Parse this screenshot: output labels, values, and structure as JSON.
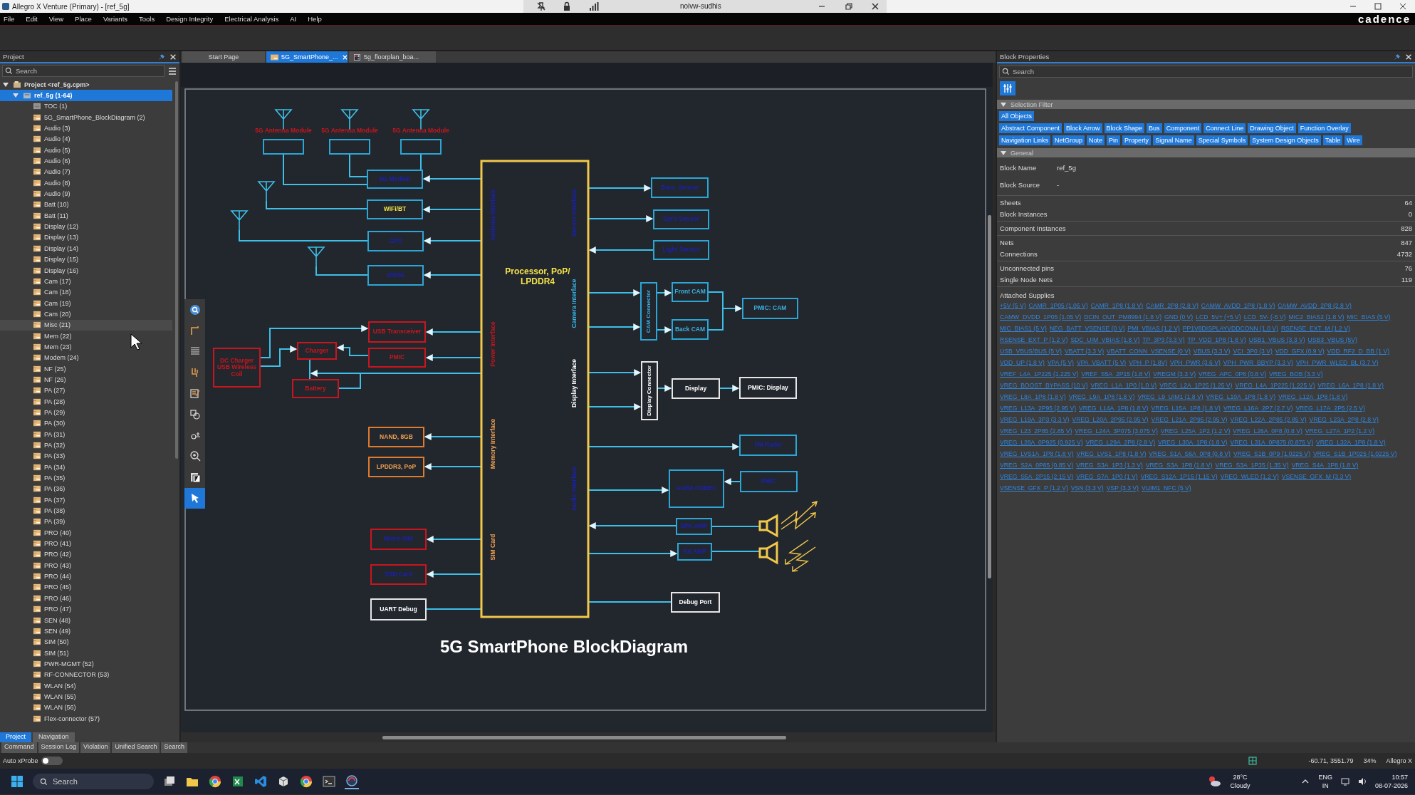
{
  "window": {
    "title": "Allegro X Venture (Primary) - [ref_5g]",
    "remote_title": "noivw-sudhis"
  },
  "menu": [
    "File",
    "Edit",
    "View",
    "Place",
    "Variants",
    "Tools",
    "Design Integrity",
    "Electrical Analysis",
    "AI",
    "Help"
  ],
  "brand": "cadence",
  "project_panel": {
    "title": "Project",
    "search_placeholder": "Search",
    "tree": {
      "label": "Project <ref_5g.cpm>",
      "expanded": true,
      "selected": false,
      "children": [
        {
          "label": "ref_5g (1-64)",
          "expanded": true,
          "selected": true,
          "children": [
            {
              "label": "TOC (1)",
              "kind": "toc",
              "hovered": false
            },
            {
              "label": "5G_SmartPhone_BlockDiagram (2)",
              "kind": "sheet",
              "hovered": false
            },
            {
              "label": "Audio (3)",
              "kind": "sheet",
              "hovered": false
            },
            {
              "label": "Audio (4)",
              "kind": "sheet",
              "hovered": false
            },
            {
              "label": "Audio (5)",
              "kind": "sheet",
              "hovered": false
            },
            {
              "label": "Audio (6)",
              "kind": "sheet",
              "hovered": false
            },
            {
              "label": "Audio (7)",
              "kind": "sheet",
              "hovered": false
            },
            {
              "label": "Audio (8)",
              "kind": "sheet",
              "hovered": false
            },
            {
              "label": "Audio (9)",
              "kind": "sheet",
              "hovered": false
            },
            {
              "label": "Batt (10)",
              "kind": "sheet",
              "hovered": false
            },
            {
              "label": "Batt (11)",
              "kind": "sheet",
              "hovered": false
            },
            {
              "label": "Display (12)",
              "kind": "sheet",
              "hovered": false
            },
            {
              "label": "Display (13)",
              "kind": "sheet",
              "hovered": false
            },
            {
              "label": "Display (14)",
              "kind": "sheet",
              "hovered": false
            },
            {
              "label": "Display (15)",
              "kind": "sheet",
              "hovered": false
            },
            {
              "label": "Display (16)",
              "kind": "sheet",
              "hovered": false
            },
            {
              "label": "Cam (17)",
              "kind": "sheet",
              "hovered": false
            },
            {
              "label": "Cam (18)",
              "kind": "sheet",
              "hovered": false
            },
            {
              "label": "Cam (19)",
              "kind": "sheet",
              "hovered": false
            },
            {
              "label": "Cam (20)",
              "kind": "sheet",
              "hovered": false
            },
            {
              "label": "Misc (21)",
              "kind": "sheet",
              "hovered": true
            },
            {
              "label": "Mem (22)",
              "kind": "sheet",
              "hovered": false
            },
            {
              "label": "Mem (23)",
              "kind": "sheet",
              "hovered": false
            },
            {
              "label": "Modem (24)",
              "kind": "sheet",
              "hovered": false
            },
            {
              "label": "NF (25)",
              "kind": "sheet",
              "hovered": false
            },
            {
              "label": "NF (26)",
              "kind": "sheet",
              "hovered": false
            },
            {
              "label": "PA (27)",
              "kind": "sheet",
              "hovered": false
            },
            {
              "label": "PA (28)",
              "kind": "sheet",
              "hovered": false
            },
            {
              "label": "PA (29)",
              "kind": "sheet",
              "hovered": false
            },
            {
              "label": "PA (30)",
              "kind": "sheet",
              "hovered": false
            },
            {
              "label": "PA (31)",
              "kind": "sheet",
              "hovered": false
            },
            {
              "label": "PA (32)",
              "kind": "sheet",
              "hovered": false
            },
            {
              "label": "PA (33)",
              "kind": "sheet",
              "hovered": false
            },
            {
              "label": "PA (34)",
              "kind": "sheet",
              "hovered": false
            },
            {
              "label": "PA (35)",
              "kind": "sheet",
              "hovered": false
            },
            {
              "label": "PA (36)",
              "kind": "sheet",
              "hovered": false
            },
            {
              "label": "PA (37)",
              "kind": "sheet",
              "hovered": false
            },
            {
              "label": "PA (38)",
              "kind": "sheet",
              "hovered": false
            },
            {
              "label": "PA (39)",
              "kind": "sheet",
              "hovered": false
            },
            {
              "label": "PRO (40)",
              "kind": "sheet",
              "hovered": false
            },
            {
              "label": "PRO (41)",
              "kind": "sheet",
              "hovered": false
            },
            {
              "label": "PRO (42)",
              "kind": "sheet",
              "hovered": false
            },
            {
              "label": "PRO (43)",
              "kind": "sheet",
              "hovered": false
            },
            {
              "label": "PRO (44)",
              "kind": "sheet",
              "hovered": false
            },
            {
              "label": "PRO (45)",
              "kind": "sheet",
              "hovered": false
            },
            {
              "label": "PRO (46)",
              "kind": "sheet",
              "hovered": false
            },
            {
              "label": "PRO (47)",
              "kind": "sheet",
              "hovered": false
            },
            {
              "label": "SEN (48)",
              "kind": "sheet",
              "hovered": false
            },
            {
              "label": "SEN (49)",
              "kind": "sheet",
              "hovered": false
            },
            {
              "label": "SIM (50)",
              "kind": "sheet",
              "hovered": false
            },
            {
              "label": "SIM (51)",
              "kind": "sheet",
              "hovered": false
            },
            {
              "label": "PWR-MGMT (52)",
              "kind": "sheet",
              "hovered": false
            },
            {
              "label": "RF-CONNECTOR (53)",
              "kind": "sheet",
              "hovered": false
            },
            {
              "label": "WLAN (54)",
              "kind": "sheet",
              "hovered": false
            },
            {
              "label": "WLAN (55)",
              "kind": "sheet",
              "hovered": false
            },
            {
              "label": "WLAN (56)",
              "kind": "sheet",
              "hovered": false
            },
            {
              "label": "Flex-connector (57)",
              "kind": "sheet",
              "hovered": false
            }
          ]
        }
      ]
    },
    "tabs": [
      {
        "label": "Project",
        "selected": true
      },
      {
        "label": "Navigation",
        "selected": false
      }
    ]
  },
  "editor_tabs": [
    {
      "label": "Start Page",
      "kind": "start",
      "selected": false
    },
    {
      "label": "5G_SmartPhone_...",
      "kind": "schematic",
      "selected": true
    },
    {
      "label": "5g_floorplan_boa...",
      "kind": "floorplan",
      "selected": false
    }
  ],
  "canvas_tools": [
    {
      "kind": "search",
      "selected": false
    },
    {
      "kind": "wire",
      "selected": false
    },
    {
      "kind": "list",
      "selected": false
    },
    {
      "kind": "pin",
      "selected": false
    },
    {
      "kind": "note",
      "selected": false
    },
    {
      "kind": "shapes",
      "selected": false
    },
    {
      "kind": "probe",
      "selected": false
    },
    {
      "kind": "zoom",
      "selected": false
    },
    {
      "kind": "text",
      "selected": false
    },
    {
      "kind": "select",
      "selected": true
    }
  ],
  "diagram": {
    "title": "5G SmartPhone BlockDiagram",
    "processor": "Processor, PoP/ LPDDR4",
    "antenna_modules": [
      {
        "label": "5G Antenna Module"
      },
      {
        "label": "5G Antenna Module"
      },
      {
        "label": "5G Antenna Module"
      }
    ],
    "interfaces": [
      {
        "label": "Antenna Interface",
        "color": "#1a22b0"
      },
      {
        "label": "Power Interface",
        "color": "#c8161e"
      },
      {
        "label": "Memory Interface",
        "color": "#f0a050"
      },
      {
        "label": "SIM Card",
        "color": "#f0a050"
      },
      {
        "label": "Sensor Interface",
        "color": "#1a22b0"
      },
      {
        "label": "Camera Interface",
        "color": "#3ab0e0"
      },
      {
        "label": "Display Interface",
        "color": "#ffffff"
      },
      {
        "label": "Audio Interface",
        "color": "#1a22b0"
      }
    ],
    "blocks": [
      {
        "label": "5G Modem",
        "kind": "rf",
        "color": "#1a22b0"
      },
      {
        "label": "WiFi/BT",
        "kind": "rf",
        "color": "#f2e24a"
      },
      {
        "label": "GPS",
        "kind": "rf",
        "color": "#1a22b0"
      },
      {
        "label": "2/3/4G",
        "kind": "rf",
        "color": "#1a22b0"
      },
      {
        "label": "USB Transceiver",
        "kind": "power",
        "color": "#c8161e"
      },
      {
        "label": "Charger",
        "kind": "power",
        "color": "#c8161e"
      },
      {
        "label": "DC Charger USB Wireless Coil",
        "kind": "power",
        "color": "#c8161e"
      },
      {
        "label": "PMIC",
        "kind": "power",
        "color": "#c8161e"
      },
      {
        "label": "Battery",
        "kind": "power",
        "color": "#c8161e"
      },
      {
        "label": "NAND, 8GB",
        "kind": "memory",
        "color": "#f0a050"
      },
      {
        "label": "LPDDR3, PoP",
        "kind": "memory",
        "color": "#f0a050"
      },
      {
        "label": "Micro-SIM",
        "kind": "sim",
        "color": "#1a22b0"
      },
      {
        "label": "SSD Card",
        "kind": "sim",
        "color": "#1a22b0"
      },
      {
        "label": "UART Debug",
        "kind": "debug",
        "color": "#ffffff"
      },
      {
        "label": "Baro. Sensor",
        "kind": "sensor",
        "color": "#1a22b0"
      },
      {
        "label": "Gyro Sensor",
        "kind": "sensor",
        "color": "#1a22b0"
      },
      {
        "label": "Light Sensor",
        "kind": "sensor",
        "color": "#1a22b0"
      },
      {
        "label": "CAM Connector",
        "kind": "cam-connector",
        "color": "#3ab0e0"
      },
      {
        "label": "Front CAM",
        "kind": "camera",
        "color": "#3ab0e0"
      },
      {
        "label": "Back CAM",
        "kind": "camera",
        "color": "#3ab0e0"
      },
      {
        "label": "PMIC: CAM",
        "kind": "camera",
        "color": "#3ab0e0"
      },
      {
        "label": "Display Connector",
        "kind": "display-connector",
        "color": "#ffffff"
      },
      {
        "label": "Display",
        "kind": "display",
        "color": "#ffffff"
      },
      {
        "label": "PMIC: Display",
        "kind": "display",
        "color": "#ffffff"
      },
      {
        "label": "FM Radio",
        "kind": "audio",
        "color": "#1a22b0"
      },
      {
        "label": "Audio CODEC",
        "kind": "audio",
        "color": "#1a22b0"
      },
      {
        "label": "PMIC",
        "kind": "audio",
        "color": "#1a22b0"
      },
      {
        "label": "SPK AMP",
        "kind": "audio",
        "color": "#1a22b0"
      },
      {
        "label": "RX AMP",
        "kind": "audio",
        "color": "#1a22b0"
      },
      {
        "label": "Debug Port",
        "kind": "debug",
        "color": "#ffffff"
      }
    ]
  },
  "properties_panel": {
    "title": "Block Properties",
    "search_placeholder": "Search",
    "selection_filter": {
      "title": "Selection Filter",
      "expanded": true,
      "chips": [
        [
          {
            "label": "All Objects",
            "selected": true
          }
        ],
        [
          {
            "label": "Abstract Component",
            "selected": true
          },
          {
            "label": "Block Arrow",
            "selected": true
          },
          {
            "label": "Block Shape",
            "selected": true
          },
          {
            "label": "Bus",
            "selected": true
          },
          {
            "label": "Component",
            "selected": true
          },
          {
            "label": "Connect Line",
            "selected": true
          },
          {
            "label": "Drawing Object",
            "selected": true
          },
          {
            "label": "Function Overlay",
            "selected": true
          }
        ],
        [
          {
            "label": "Navigation Links",
            "selected": true
          },
          {
            "label": "NetGroup",
            "selected": true
          },
          {
            "label": "Note",
            "selected": true
          },
          {
            "label": "Pin",
            "selected": true
          },
          {
            "label": "Property",
            "selected": true
          },
          {
            "label": "Signal Name",
            "selected": true
          },
          {
            "label": "Special Symbols",
            "selected": true
          },
          {
            "label": "System Design Objects",
            "selected": true
          },
          {
            "label": "Table",
            "selected": true
          },
          {
            "label": "Wire",
            "selected": true
          }
        ]
      ]
    },
    "general": {
      "title": "General",
      "expanded": true,
      "groups": [
        {
          "kind": "inline",
          "rows": [
            {
              "label": "Block Name",
              "value": "ref_5g"
            },
            {
              "label": "Block Source",
              "value": "-"
            }
          ]
        },
        {
          "kind": "count",
          "rows": [
            {
              "label": "Sheets",
              "value": "64"
            },
            {
              "label": "Block Instances",
              "value": "0"
            }
          ]
        },
        {
          "kind": "count",
          "rows": [
            {
              "label": "Component Instances",
              "value": "828"
            }
          ]
        },
        {
          "kind": "count",
          "rows": [
            {
              "label": "Nets",
              "value": "847"
            },
            {
              "label": "Connections",
              "value": "4732"
            }
          ]
        },
        {
          "kind": "count",
          "rows": [
            {
              "label": "Unconnected pins",
              "value": "76"
            },
            {
              "label": "Single Node Nets",
              "value": "119"
            }
          ]
        }
      ],
      "supplies_title": "Attached Supplies",
      "supplies": [
        "+5V (5 V)",
        "CAMR_1P05 (1.05 V)",
        "CAMR_1P8 (1.8 V)",
        "CAMR_2P8 (2.8 V)",
        "CAMW_AVDD_1P8 (1.8 V)",
        "CAMW_AVDD_2P8 (2.8 V)",
        "CAMW_DVDD_1P05 (1.05 V)",
        "DCIN_OUT_PM8994 (1.8 V)",
        "GND (0 V)",
        "LCD_5V+ (+5 V)",
        "LCD_5V- (-5 V)",
        "MIC2_BIAS2 (1.8 V)",
        "MIC_BIAS (5 V)",
        "MIC_BIAS1 (5 V)",
        "NEG_BATT_VSENSE (0 V)",
        "PMI_VBIAS (1.2 V)",
        "PP1V8DISPLAYVDDCONN (1.0 V)",
        "RSENSE_EXT_M (1.2 V)",
        "RSENSE_EXT_P (1.2 V)",
        "SDC_UIM_VBIAS (1.8 V)",
        "TP_3P3 (3.3 V)",
        "TP_VDD_1P8 (1.8 V)",
        "USB1_VBUS (3.3 V)",
        "USB3_VBUS (5V)",
        "USB_VBUS/BUS (5 V)",
        "VBATT (3.3 V)",
        "VBATT_CONN_VSENSE (0 V)",
        "VBUS (3.3 V)",
        "VCI_3P0 (3 V)",
        "VDD_GFX (0.9 V)",
        "VDD_RF2_D_BB (1 V)",
        "VDD_UP (1.8 V)",
        "VPA (5 V)",
        "VPA_VBATT (5 V)",
        "VPH_P (1.8V)",
        "VPH_PWR (3.6 V)",
        "VPH_PWR_BBYP (3.3 V)",
        "VPH_PWR_WLED_BL (3.7 V)",
        "VREF_L4A_1P225 (1.225 V)",
        "VREF_S5A_2P15 (1.8 V)",
        "VREGM (3.3 V)",
        "VREG_APC_0P8 (0.8 V)",
        "VREG_BOB (3.3 V)",
        "VREG_BOOST_BYPASS (10 V)",
        "VREG_L1A_1P0 (1.0 V)",
        "VREG_L2A_1P25 (1.25 V)",
        "VREG_L4A_1P225 (1.225 V)",
        "VREG_L6A_1P8 (1.8 V)",
        "VREG_L8A_1P8 (1.8 V)",
        "VREG_L9A_1P8 (1.8 V)",
        "VREG_L9_UIM1 (1.8 V)",
        "VREG_L10A_1P8 (1.8 V)",
        "VREG_L12A_1P8 (1.8 V)",
        "VREG_L13A_2P95 (2.95 V)",
        "VREG_L14A_1P8 (1.8 V)",
        "VREG_L15A_1P8 (1.8 V)",
        "VREG_L16A_2P7 (2.7 V)",
        "VREG_L17A_2P5 (2.5 V)",
        "VREG_L19A_3P3 (3.3 V)",
        "VREG_L20A_2P95 (2.95 V)",
        "VREG_L21A_2P95 (2.95 V)",
        "VREG_L22A_2P85 (2.85 V)",
        "VREG_L23A_2P8 (2.8 V)",
        "VREG_L23_2P85 (2.85 V)",
        "VREG_L24A_3P075 (3.075 V)",
        "VREG_L25A_1P2 (1.2 V)",
        "VREG_L26A_0P8 (0.8 V)",
        "VREG_L27A_1P2 (1.2 V)",
        "VREG_L28A_0P925 (0.925 V)",
        "VREG_L29A_2P8 (2.8 V)",
        "VREG_L30A_1P8 (1.8 V)",
        "VREG_L31A_0P875 (0.875 V)",
        "VREG_L32A_1P8 (1.8 V)",
        "VREG_LVS1A_1P8 (1.8 V)",
        "VREG_LVS1_1P8 (1.8 V)",
        "VREG_S1A_S6A_0P8 (0.8 V)",
        "VREG_S1B_0P9 (1.0225 V)",
        "VREG_S1B_1P025 (1.0225 V)",
        "VREG_S2A_0P85 (0.85 V)",
        "VREG_S3A_1P3 (1.3 V)",
        "VREG_S3A_1P8 (1.8 V)",
        "VREG_S3A_1P35 (1.35 V)",
        "VREG_S4A_1P8 (1.8 V)",
        "VREG_S5A_2P15 (2.15 V)",
        "VREG_S7A_1P0 (1 V)",
        "VREG_S12A_1P15 (1.15 V)",
        "VREG_WLED (1.2 V)",
        "VSENSE_GFX_M (3.3 V)",
        "VSENSE_GFX_P (1.2 V)",
        "VSN (3.3 V)",
        "VSP (3.3 V)",
        "VUIM1_NFC (5 V)"
      ]
    }
  },
  "bottom_tabs": [
    "Command",
    "Session Log",
    "Violation",
    "Unified Search",
    "Search"
  ],
  "status_bar": {
    "xprobe_label": "Auto xProbe",
    "xprobe_on": false,
    "coordinates": "-60.71, 3551.79",
    "zoom": "34%",
    "product": "Allegro X"
  },
  "taskbar": {
    "search_placeholder": "Search",
    "temperature": "28°C",
    "weather": "Cloudy",
    "language": "ENG",
    "region": "IN",
    "time": "10:57",
    "date": "08-07-2026"
  }
}
